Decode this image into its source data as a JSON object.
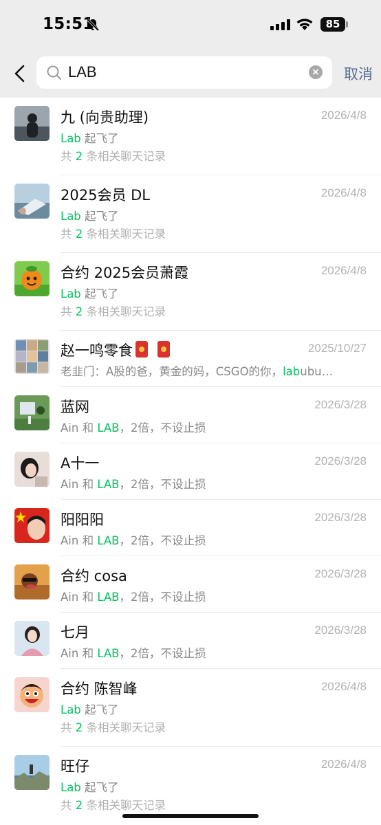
{
  "status_bar": {
    "time": "15:51",
    "battery": "85"
  },
  "search": {
    "query": "LAB",
    "cancel_label": "取消"
  },
  "results": [
    {
      "name": "九 (向贵助理)",
      "date": "2026/4/8",
      "match_hl": "Lab",
      "match_rest": " 起飞了",
      "count_pre": "共 ",
      "count": "2",
      "count_post": " 条相关聊天记录"
    },
    {
      "name": "2025会员 DL",
      "date": "2026/4/8",
      "match_hl": "Lab",
      "match_rest": " 起飞了",
      "count_pre": "共 ",
      "count": "2",
      "count_post": " 条相关聊天记录"
    },
    {
      "name": "合约 2025会员萧霞",
      "date": "2026/4/8",
      "match_hl": "Lab",
      "match_rest": " 起飞了",
      "count_pre": "共 ",
      "count": "2",
      "count_post": " 条相关聊天记录"
    },
    {
      "name": "赵一鸣零食",
      "date": "2025/10/27",
      "msg_pre": "老韭门：A股的爸，黄金的妈，CSGO的你，",
      "msg_hl": "lab",
      "msg_post": "ubu…"
    },
    {
      "name": "蓝网",
      "date": "2026/3/28",
      "msg_pre": "Ain 和 ",
      "msg_hl": "LAB",
      "msg_post": "，2倍，不设止损"
    },
    {
      "name": "A十一",
      "date": "2026/3/28",
      "msg_pre": "Ain 和 ",
      "msg_hl": "LAB",
      "msg_post": "，2倍，不设止损"
    },
    {
      "name": "阳阳阳",
      "date": "2026/3/28",
      "msg_pre": "Ain 和 ",
      "msg_hl": "LAB",
      "msg_post": "，2倍，不设止损"
    },
    {
      "name": "合约 cosa",
      "date": "2026/3/28",
      "msg_pre": "Ain 和 ",
      "msg_hl": "LAB",
      "msg_post": "，2倍，不设止损"
    },
    {
      "name": "七月",
      "date": "2026/3/28",
      "msg_pre": "Ain 和 ",
      "msg_hl": "LAB",
      "msg_post": "，2倍，不设止损"
    },
    {
      "name": "合约 陈智峰",
      "date": "2026/4/8",
      "match_hl": "Lab",
      "match_rest": " 起飞了",
      "count_pre": "共 ",
      "count": "2",
      "count_post": " 条相关聊天记录"
    },
    {
      "name": "旺仔",
      "date": "2026/4/8",
      "match_hl": "Lab",
      "match_rest": " 起飞了",
      "count_pre": "共 ",
      "count": "2",
      "count_post": " 条相关聊天记录"
    }
  ],
  "colors": {
    "highlight": "#07c160",
    "link": "#576b95",
    "header_bg": "#ededed"
  }
}
